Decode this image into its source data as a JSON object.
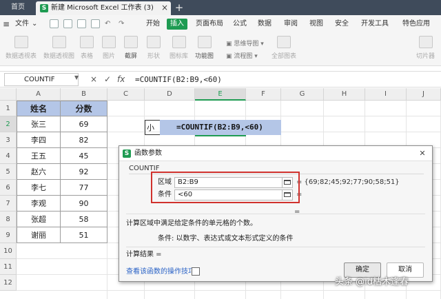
{
  "titlebar": {
    "home": "首页",
    "doc_tab": "新建 Microsoft Excel 工作表 (3)",
    "close": "×",
    "new_tab": "+"
  },
  "menubar": {
    "file": "文件",
    "file_arrow": "⌄",
    "items": [
      "开始",
      "插入",
      "页面布局",
      "公式",
      "数据",
      "审阅",
      "视图",
      "安全",
      "开发工具",
      "特色应用"
    ],
    "active": "插入"
  },
  "ribbon": {
    "buttons": [
      "数据透视表",
      "数据透视图",
      "表格",
      "图片",
      "截屏",
      "形状",
      "图标库",
      "功能图",
      "全部图表",
      "切片器"
    ],
    "mindmap": "思维导图",
    "flowchart": "流程图"
  },
  "formula_bar": {
    "name_box": "COUNTIF",
    "cancel": "×",
    "confirm": "✓",
    "fx": "fx",
    "formula": "=COUNTIF(B2:B9,<60)"
  },
  "sheet": {
    "columns": [
      "A",
      "B",
      "C",
      "D",
      "E",
      "F",
      "G",
      "H",
      "I",
      "J"
    ],
    "rows": [
      "1",
      "2",
      "3",
      "4",
      "5",
      "6",
      "7",
      "8",
      "9",
      "10",
      "11",
      "12"
    ],
    "header_name": "姓名",
    "header_score": "分数",
    "names": [
      "张三",
      "李四",
      "王五",
      "赵六",
      "李七",
      "李观",
      "张超",
      "谢丽"
    ],
    "scores": [
      "69",
      "82",
      "45",
      "92",
      "77",
      "90",
      "58",
      "51"
    ],
    "d2": "小于",
    "e2": "=COUNTIF(B2:B9,<60)"
  },
  "dialog": {
    "title": "函数参数",
    "close": "✕",
    "function": "COUNTIF",
    "range_label": "区域",
    "range_value": "B2:B9",
    "range_result": "= {69;82;45;92;77;90;58;51}",
    "criteria_label": "条件",
    "criteria_value": "<60",
    "criteria_result": "=",
    "result_eq": "=",
    "description": "计算区域中满足给定条件的单元格的个数。",
    "criteria_help": "条件:  以数字、表达式或文本形式定义的条件",
    "calc_result": "计算结果 =",
    "help_link": "查看该函数的操作技巧",
    "ok": "确定",
    "cancel": "取消"
  },
  "watermark": "头条 @id枯木逢春",
  "colors": {
    "accent": "#1e9b52",
    "header_fill": "#b4c6e7",
    "highlight_box": "#d0312d",
    "titlebar": "#3f4b5b"
  }
}
